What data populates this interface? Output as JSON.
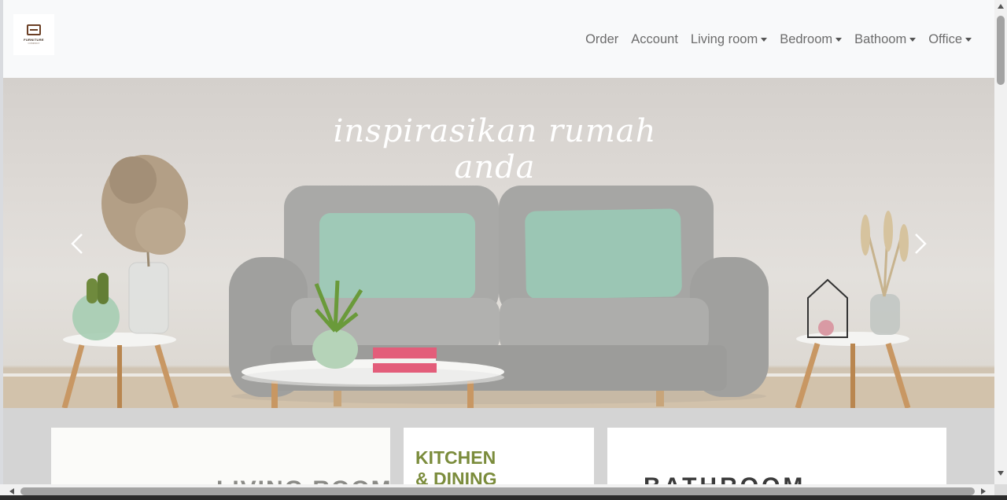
{
  "brand": {
    "name": "FURNITURE",
    "subtitle": "COMPANY"
  },
  "nav": {
    "items": [
      {
        "label": "Order",
        "dropdown": false
      },
      {
        "label": "Account",
        "dropdown": false
      },
      {
        "label": "Living room",
        "dropdown": true
      },
      {
        "label": "Bedroom",
        "dropdown": true
      },
      {
        "label": "Bathoom",
        "dropdown": true
      },
      {
        "label": "Office",
        "dropdown": true
      }
    ]
  },
  "hero": {
    "title": "inspirasikan rumah anda",
    "prev_icon": "chevron-left-icon",
    "next_icon": "chevron-right-icon"
  },
  "cards": {
    "living_room": "LIVING ROOM",
    "kitchen": "KITCHEN & DINING",
    "kitchen_line1": "KITCHEN",
    "kitchen_line2": "& DINING",
    "bathroom": "BATHROOM"
  },
  "colors": {
    "navbar_bg": "#f8f9fa",
    "nav_text": "#6c6c6c",
    "sofa": "#a9a9a7",
    "pillow": "#9fc9b7",
    "kitchen_text": "#7b8c3c",
    "section_bg": "#d4d4d4"
  }
}
